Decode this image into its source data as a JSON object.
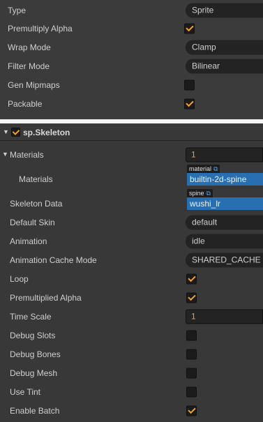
{
  "top_panel": {
    "rows": [
      {
        "label": "Type",
        "kind": "select",
        "value": "Sprite"
      },
      {
        "label": "Premultiply Alpha",
        "kind": "checkbox",
        "checked": true
      },
      {
        "label": "Wrap Mode",
        "kind": "select",
        "value": "Clamp"
      },
      {
        "label": "Filter Mode",
        "kind": "select",
        "value": "Bilinear"
      },
      {
        "label": "Gen Mipmaps",
        "kind": "checkbox",
        "checked": false
      },
      {
        "label": "Packable",
        "kind": "checkbox",
        "checked": true
      }
    ]
  },
  "component": {
    "title": "sp.Skeleton",
    "enabled": true,
    "materials": {
      "label": "Materials",
      "count": "1",
      "item_label": "Materials",
      "item_tag": "material",
      "item_value": "builtin-2d-spine"
    },
    "skeleton_data": {
      "label": "Skeleton Data",
      "tag": "spine",
      "value": "wushi_lr"
    },
    "default_skin": {
      "label": "Default Skin",
      "value": "default"
    },
    "animation": {
      "label": "Animation",
      "value": "idle"
    },
    "animation_cache_mode": {
      "label": "Animation Cache Mode",
      "value": "SHARED_CACHE"
    },
    "loop": {
      "label": "Loop",
      "checked": true
    },
    "premultiplied_alpha": {
      "label": "Premultiplied Alpha",
      "checked": true
    },
    "time_scale": {
      "label": "Time Scale",
      "value": "1"
    },
    "debug_slots": {
      "label": "Debug Slots",
      "checked": false
    },
    "debug_bones": {
      "label": "Debug Bones",
      "checked": false
    },
    "debug_mesh": {
      "label": "Debug Mesh",
      "checked": false
    },
    "use_tint": {
      "label": "Use Tint",
      "checked": false
    },
    "enable_batch": {
      "label": "Enable Batch",
      "checked": true
    }
  },
  "colors": {
    "accent": "#f0a030",
    "asset_blue": "#276fb0",
    "link_icon": "#5aa0e6"
  },
  "icons": {
    "collapse": "triangle-down-icon",
    "external_link": "external-link-icon"
  }
}
